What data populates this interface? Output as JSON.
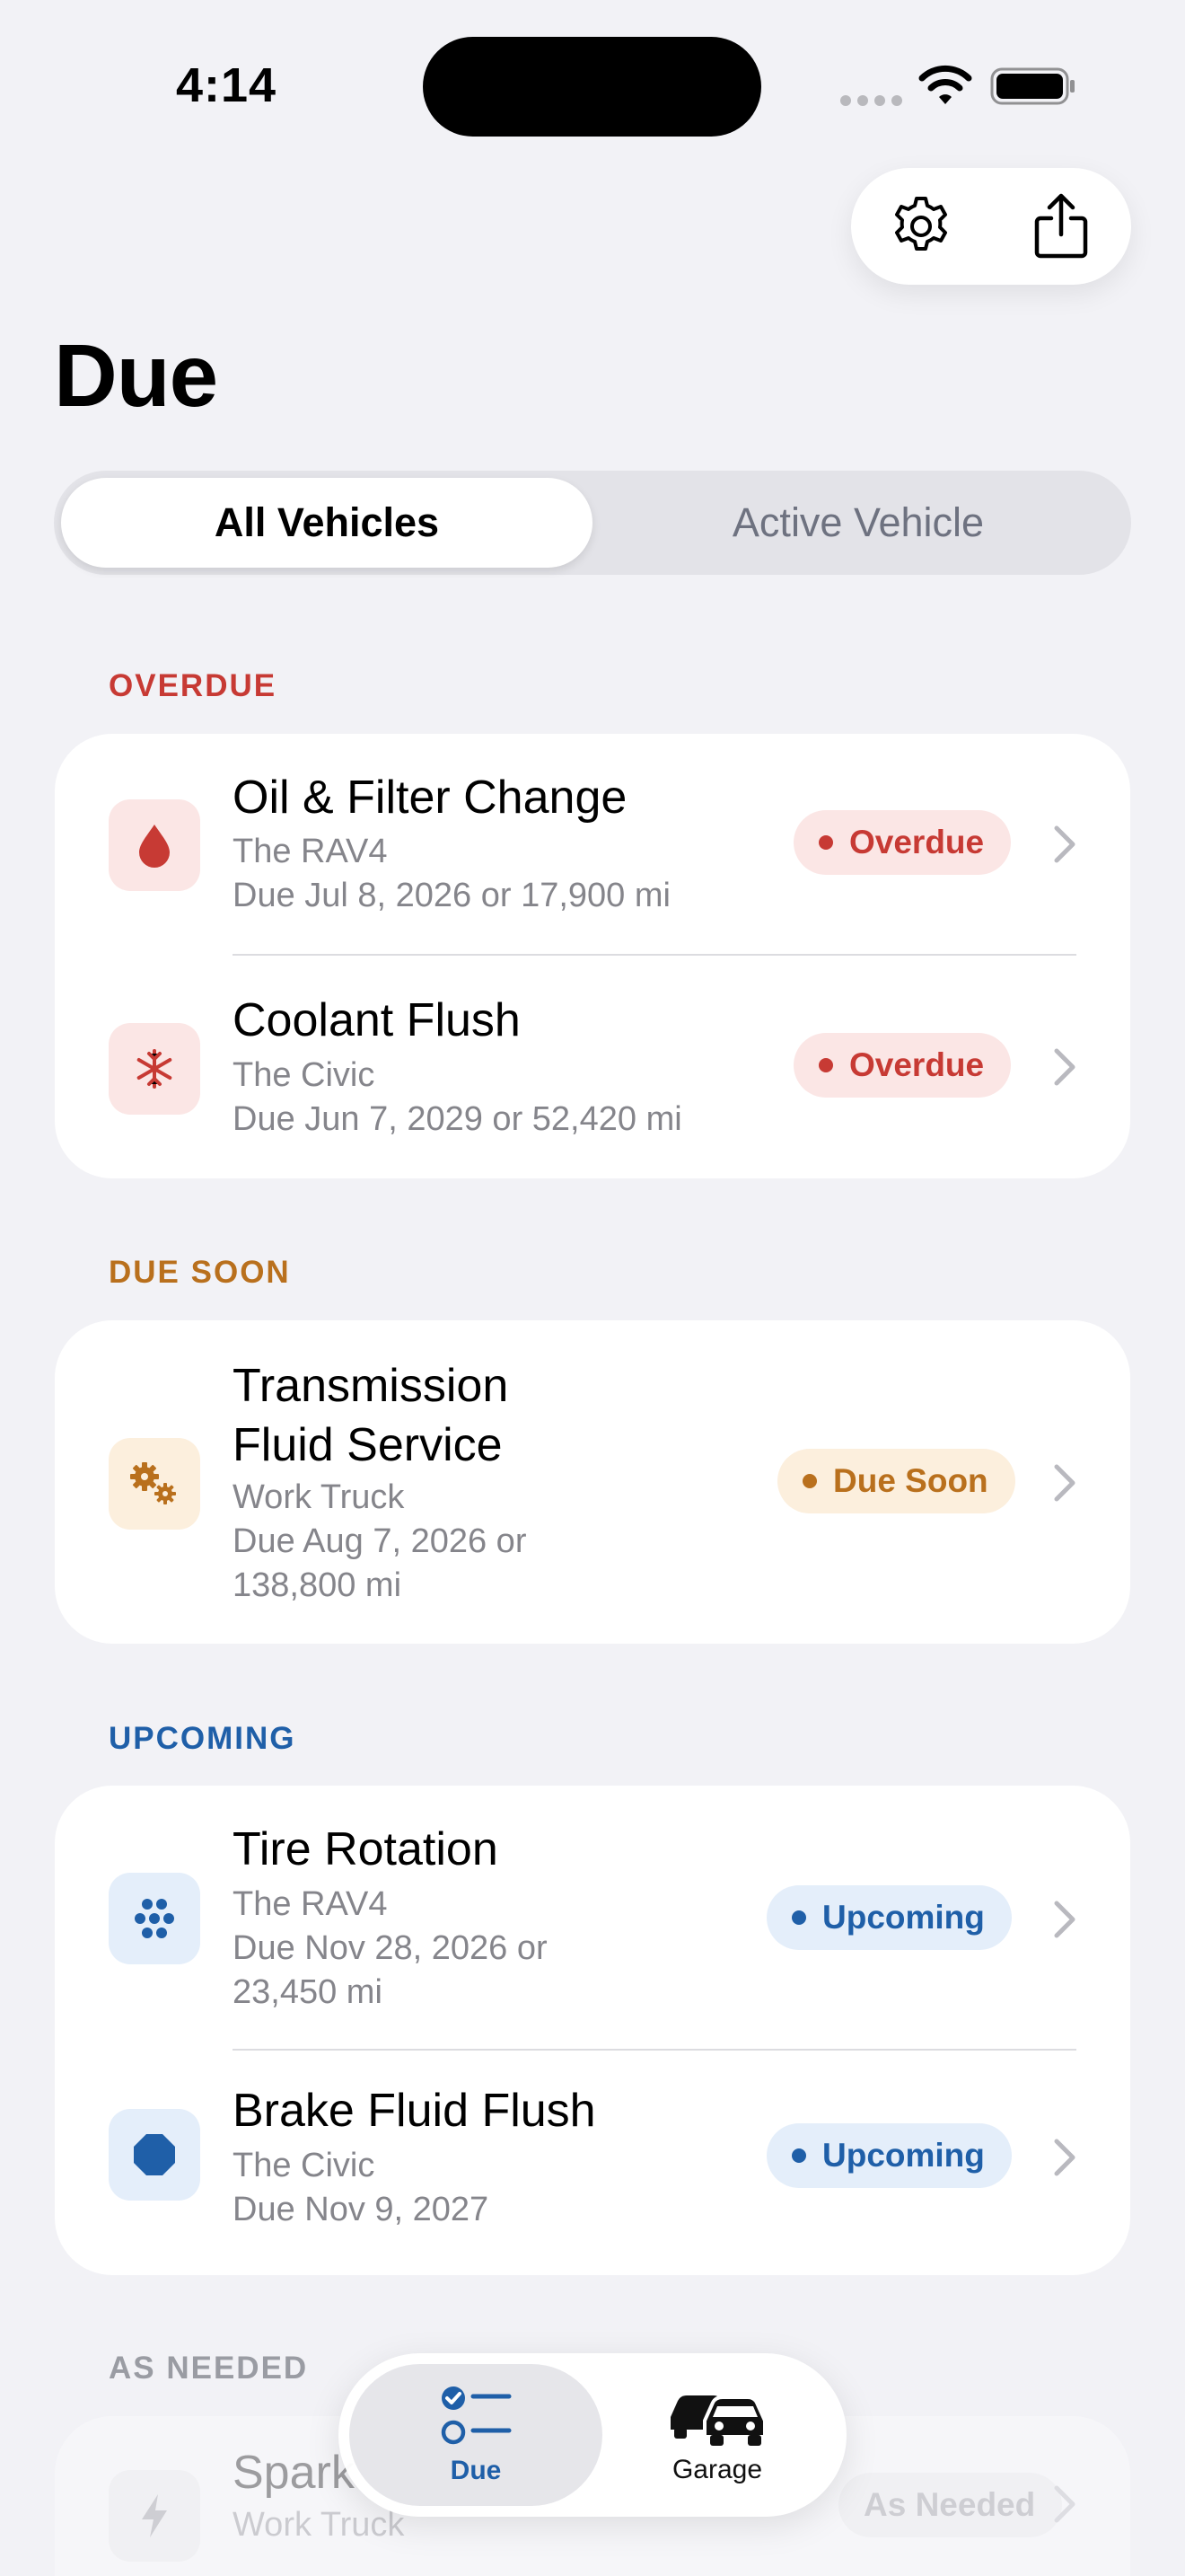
{
  "status_bar": {
    "time": "4:14"
  },
  "header": {
    "title": "Due"
  },
  "top_actions": {
    "settings_icon": "gear-icon",
    "share_icon": "share-icon"
  },
  "segmented": {
    "options": [
      "All Vehicles",
      "Active Vehicle"
    ],
    "selected": "All Vehicles"
  },
  "sections": {
    "overdue": {
      "header": "OVERDUE",
      "items": [
        {
          "title": "Oil & Filter Change",
          "vehicle": "The RAV4",
          "due": "Due Jul 8, 2026 or 17,900 mi",
          "status": "Overdue",
          "icon": "drop-icon"
        },
        {
          "title": "Coolant Flush",
          "vehicle": "The Civic",
          "due": "Due Jun 7, 2029 or 52,420 mi",
          "status": "Overdue",
          "icon": "snowflake-icon"
        }
      ]
    },
    "due_soon": {
      "header": "DUE SOON",
      "items": [
        {
          "title_line1": "Transmission",
          "title_line2": "Fluid Service",
          "vehicle": "Work Truck",
          "due_line1": "Due Aug 7, 2026 or",
          "due_line2": "138,800 mi",
          "status": "Due Soon",
          "icon": "gears-icon"
        }
      ]
    },
    "upcoming": {
      "header": "UPCOMING",
      "items": [
        {
          "title": "Tire Rotation",
          "vehicle": "The RAV4",
          "due_line1": "Due Nov 28, 2026 or",
          "due_line2": "23,450 mi",
          "status": "Upcoming",
          "icon": "tire-rotation-icon"
        },
        {
          "title": "Brake Fluid Flush",
          "vehicle": "The Civic",
          "due": "Due Nov 9, 2027",
          "status": "Upcoming",
          "icon": "octagon-icon"
        }
      ]
    },
    "as_needed": {
      "header": "AS NEEDED",
      "items": [
        {
          "title": "Spark",
          "vehicle": "Work Truck",
          "status": "As Needed",
          "icon": "bolt-icon"
        }
      ]
    }
  },
  "tab_bar": {
    "tabs": [
      {
        "label": "Due",
        "icon": "checklist-icon",
        "selected": true
      },
      {
        "label": "Garage",
        "icon": "cars-icon",
        "selected": false
      }
    ]
  },
  "colors": {
    "overdue": "#c73a34",
    "due_soon": "#b9701d",
    "upcoming": "#1f5fa8",
    "background": "#f2f2f6"
  }
}
